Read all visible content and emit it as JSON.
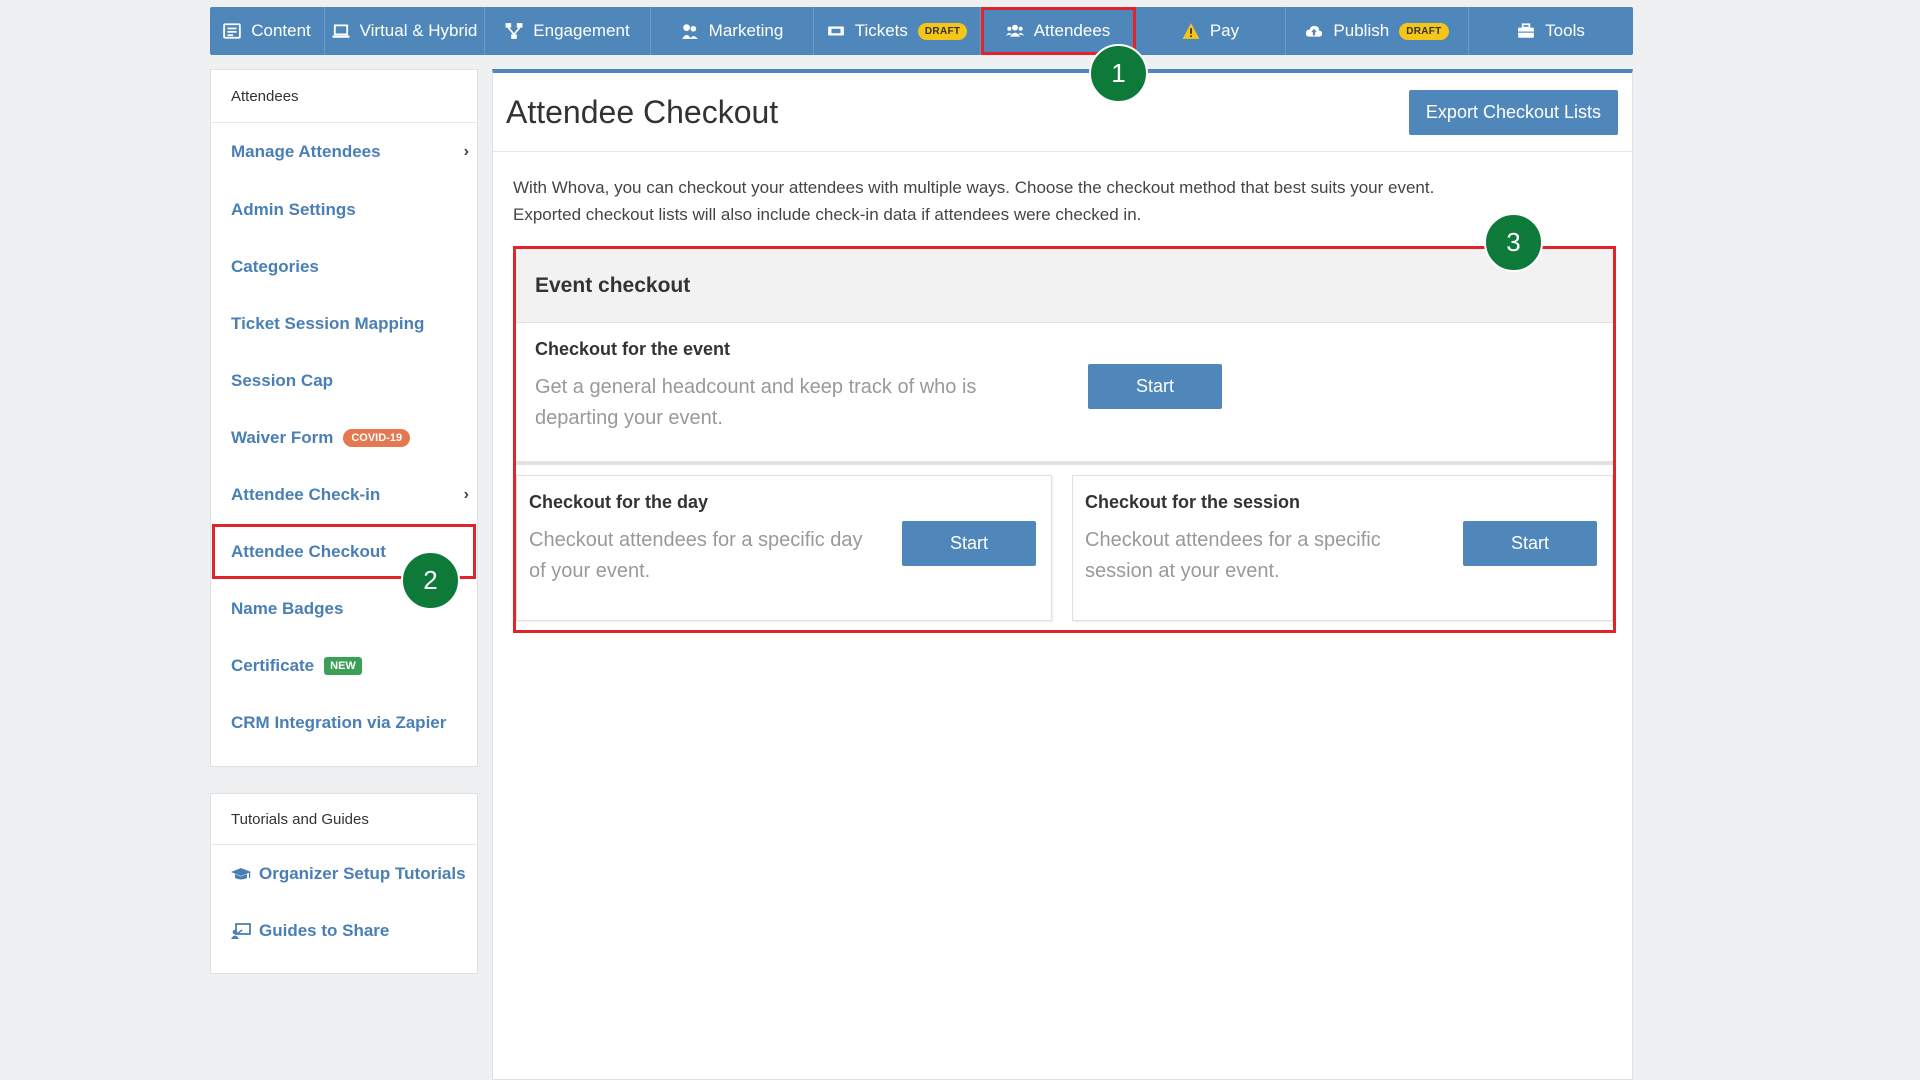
{
  "topnav": {
    "items": [
      {
        "label": "Content",
        "icon": "list-icon"
      },
      {
        "label": "Virtual & Hybrid",
        "icon": "laptop-icon"
      },
      {
        "label": "Engagement",
        "icon": "network-icon"
      },
      {
        "label": "Marketing",
        "icon": "megaphone-icon"
      },
      {
        "label": "Tickets",
        "icon": "ticket-icon",
        "badge": "DRAFT"
      },
      {
        "label": "Attendees",
        "icon": "users-icon",
        "active": true
      },
      {
        "label": "Pay",
        "icon": "warning-icon"
      },
      {
        "label": "Publish",
        "icon": "cloud-upload-icon",
        "badge": "DRAFT"
      },
      {
        "label": "Tools",
        "icon": "toolbox-icon"
      }
    ]
  },
  "sidebar": {
    "header": "Attendees",
    "items": [
      {
        "label": "Manage Attendees",
        "chevron": "›"
      },
      {
        "label": "Admin Settings"
      },
      {
        "label": "Categories"
      },
      {
        "label": "Ticket Session Mapping"
      },
      {
        "label": "Session Cap"
      },
      {
        "label": "Waiver Form",
        "tag": "COVID-19"
      },
      {
        "label": "Attendee Check-in",
        "chevron": "›"
      },
      {
        "label": "Attendee Checkout",
        "selected": true
      },
      {
        "label": "Name Badges"
      },
      {
        "label": "Certificate",
        "tag": "NEW"
      },
      {
        "label": "CRM Integration via Zapier"
      }
    ]
  },
  "tutorials": {
    "header": "Tutorials and Guides",
    "items": [
      {
        "label": "Organizer Setup Tutorials",
        "icon": "graduation-cap-icon"
      },
      {
        "label": "Guides to Share",
        "icon": "share-guide-icon"
      }
    ]
  },
  "main": {
    "title": "Attendee Checkout",
    "export_label": "Export Checkout Lists",
    "intro_line1": "With Whova, you can checkout your attendees with multiple ways. Choose the checkout method that best suits your event.",
    "intro_line2": "Exported checkout lists will also include check-in data if attendees were checked in.",
    "checkout": {
      "heading": "Event checkout",
      "event": {
        "title": "Checkout for the event",
        "desc": "Get a general headcount and keep track of who is departing your event.",
        "button": "Start"
      },
      "day": {
        "title": "Checkout for the day",
        "desc": "Checkout attendees for a specific day of your event.",
        "button": "Start"
      },
      "session": {
        "title": "Checkout for the session",
        "desc": "Checkout attendees for a specific session at your event.",
        "button": "Start"
      }
    }
  },
  "markers": [
    "1",
    "2",
    "3"
  ],
  "colors": {
    "nav_bg": "#4f87bb",
    "link": "#4a7fb5",
    "highlight": "#e0242b",
    "marker": "#0d7a3a"
  }
}
